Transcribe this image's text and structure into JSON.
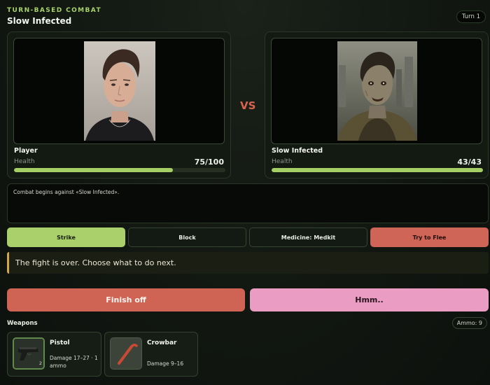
{
  "header": {
    "eyebrow": "TURN-BASED COMBAT",
    "enemy_title": "Slow Infected",
    "turn": "Turn 1"
  },
  "player": {
    "name": "Player",
    "health_label": "Health",
    "health_text": "75/100",
    "health_fraction": 0.75
  },
  "vs_label": "VS",
  "enemy": {
    "name": "Slow Infected",
    "health_label": "Health",
    "health_text": "43/43",
    "health_fraction": 1.0
  },
  "log": {
    "text": "Combat begins against «Slow Infected»."
  },
  "actions": {
    "strike": "Strike",
    "block": "Block",
    "medicine": "Medicine: Medkit",
    "flee": "Try to Flee"
  },
  "notice": "The fight is over. Choose what to do next.",
  "finish_button": "Finish off",
  "hmm_button": "Hmm..",
  "weapons": {
    "title": "Weapons",
    "ammo": "Ammo: 9",
    "items": [
      {
        "name": "Pistol",
        "stats": "Damage 17–27 · 1 ammo",
        "icon": "pistol-icon",
        "badge": "2"
      },
      {
        "name": "Crowbar",
        "stats": "Damage 9–16",
        "icon": "crowbar-icon"
      }
    ]
  },
  "colors": {
    "accent_green": "#a9d06b",
    "danger_red": "#cf6556",
    "pink": "#ea9cc2",
    "notice_border": "#d2a64a"
  }
}
